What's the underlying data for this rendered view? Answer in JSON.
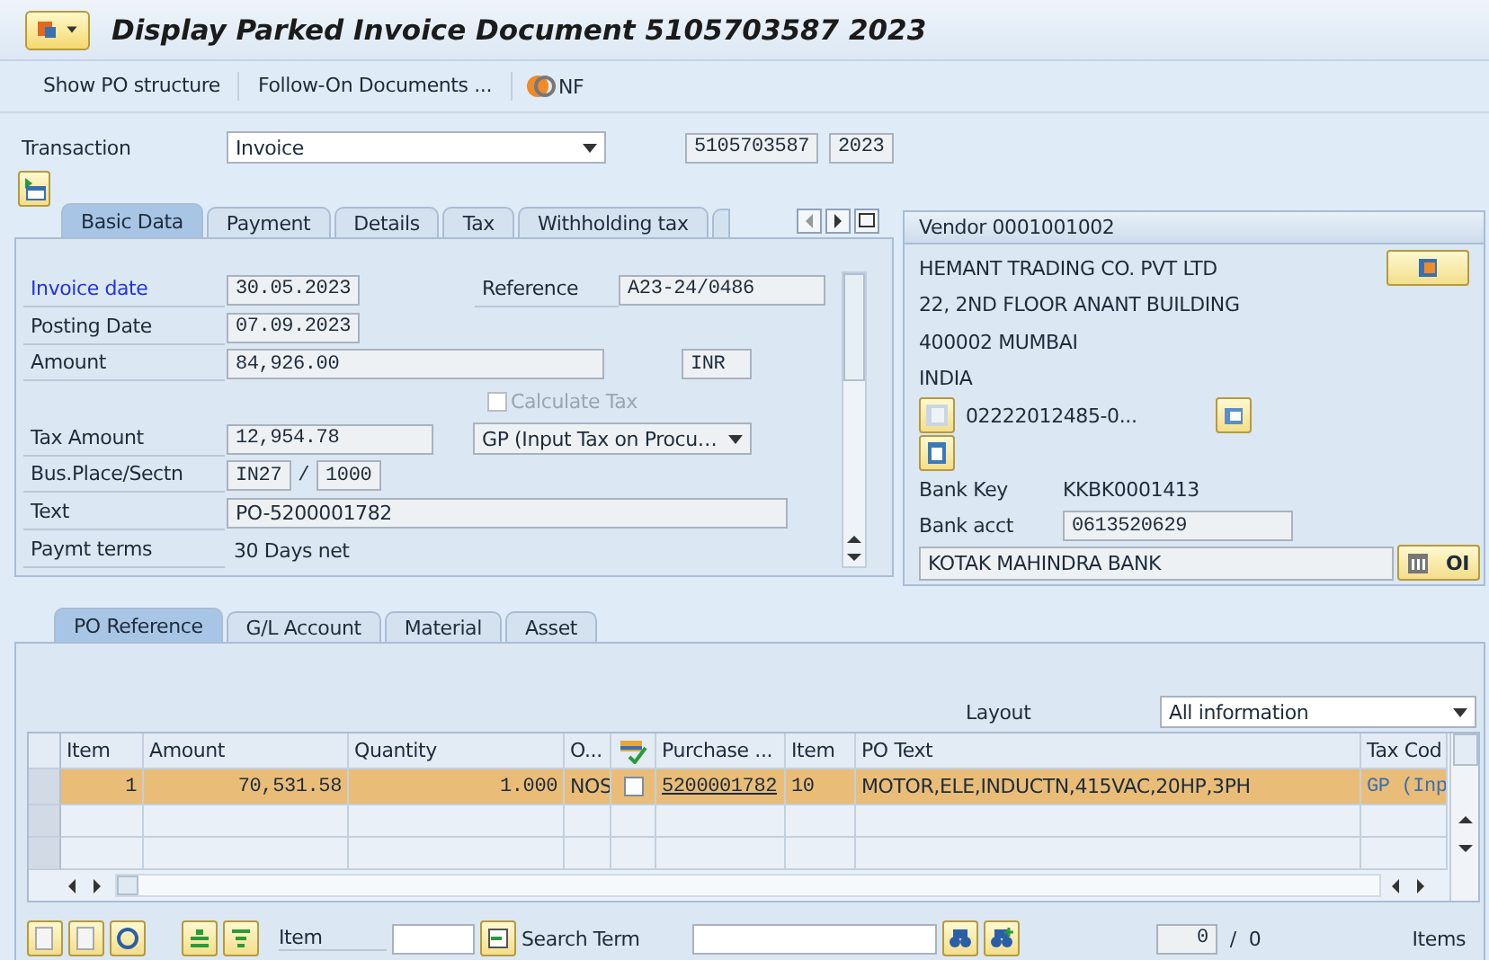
{
  "window": {
    "title": "Display Parked Invoice Document 5105703587 2023"
  },
  "toolbar": [
    {
      "label": "Show PO structure",
      "kind": "text"
    },
    {
      "label": "Follow-On Documents ...",
      "kind": "text"
    },
    {
      "label": "NF",
      "kind": "icon_text"
    }
  ],
  "transaction": {
    "label": "Transaction",
    "value": "Invoice",
    "document_number": "5105703587",
    "fiscal_year": "2023"
  },
  "header_tabs": [
    {
      "label": "Basic Data",
      "selected": true
    },
    {
      "label": "Payment",
      "selected": false
    },
    {
      "label": "Details",
      "selected": false
    },
    {
      "label": "Tax",
      "selected": false
    },
    {
      "label": "Withholding tax",
      "selected": false
    }
  ],
  "basic_data": {
    "invoice_date": {
      "label": "Invoice date",
      "value": "30.05.2023",
      "required": true
    },
    "reference": {
      "label": "Reference",
      "value": "A23-24/0486"
    },
    "posting_date": {
      "label": "Posting Date",
      "value": "07.09.2023",
      "required": false
    },
    "amount": {
      "label": "Amount",
      "value": "84,926.00",
      "currency": "INR"
    },
    "calculate_tax": {
      "label": "Calculate Tax",
      "checked": false,
      "disabled": true
    },
    "tax_amount": {
      "label": "Tax Amount",
      "value": "12,954.78",
      "tax_code": "GP (Input Tax on Procu…"
    },
    "business_place": {
      "label": "Bus.Place/Sectn",
      "place": "IN27",
      "separator": "/",
      "section": "1000"
    },
    "text": {
      "label": "Text",
      "value": "PO-5200001782"
    },
    "payment_terms": {
      "label": "Paymt terms",
      "value": "30 Days net"
    }
  },
  "vendor": {
    "title": "Vendor 0001001002",
    "address": [
      "HEMANT TRADING CO. PVT LTD",
      "22, 2ND FLOOR ANANT BUILDING",
      "400002 MUMBAI",
      "INDIA"
    ],
    "phone": "02222012485-0...",
    "bank_key": {
      "label": "Bank Key",
      "value": "KKBK0001413"
    },
    "bank_account": {
      "label": "Bank acct",
      "value": "0613520629"
    },
    "bank_name": "KOTAK MAHINDRA BANK",
    "open_items_button": "OI"
  },
  "item_tabs": [
    {
      "label": "PO Reference",
      "selected": true
    },
    {
      "label": "G/L Account",
      "selected": false
    },
    {
      "label": "Material",
      "selected": false
    },
    {
      "label": "Asset",
      "selected": false
    }
  ],
  "layout": {
    "label": "Layout",
    "value": "All information"
  },
  "table": {
    "columns": [
      {
        "label": "Item",
        "kind": "text"
      },
      {
        "label": "Amount",
        "kind": "text"
      },
      {
        "label": "Quantity",
        "kind": "text"
      },
      {
        "label": "O...",
        "kind": "text"
      },
      {
        "kind": "icon"
      },
      {
        "label": "Purchase ...",
        "kind": "text"
      },
      {
        "label": "Item",
        "kind": "text"
      },
      {
        "label": "PO Text",
        "kind": "text"
      },
      {
        "label": "Tax Cod",
        "kind": "text"
      }
    ],
    "rows": [
      {
        "selected": true,
        "item": "1",
        "amount": "70,531.58",
        "quantity": "1.000",
        "unit": "NOS",
        "checked": false,
        "purchase_order": "5200001782",
        "po_item": "10",
        "po_text": "MOTOR,ELE,INDUCTN,415VAC,20HP,3PH",
        "tax_code": "GP (Inp"
      }
    ]
  },
  "footer": {
    "item_label": "Item",
    "search_label": "Search Term",
    "count": "0",
    "separator": "/",
    "total": "0",
    "items_label": "Items"
  }
}
